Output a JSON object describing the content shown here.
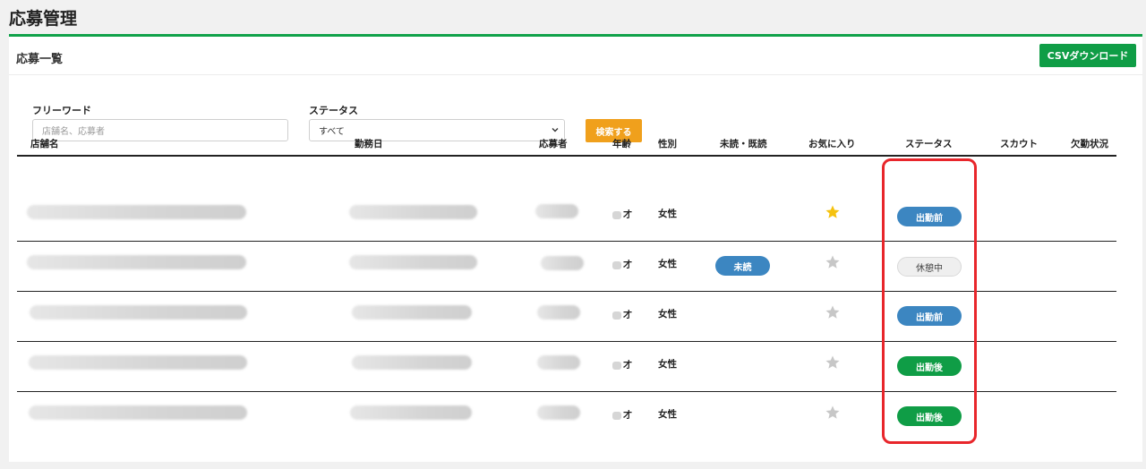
{
  "page_title": "応募管理",
  "card": {
    "title": "応募一覧",
    "csv_label": "CSVダウンロード"
  },
  "filters": {
    "freeword_label": "フリーワード",
    "freeword_placeholder": "店舗名、応募者",
    "status_label": "ステータス",
    "status_value": "すべて",
    "search_label": "検索する"
  },
  "table": {
    "headers": {
      "store": "店舗名",
      "date": "勤務日",
      "applicant": "応募者",
      "age": "年齢",
      "gender": "性別",
      "read": "未読・既読",
      "favorite": "お気に入り",
      "status": "ステータス",
      "scout": "スカウト",
      "absence": "欠勤状況"
    },
    "rows": [
      {
        "age_suffix": "才",
        "gender": "女性",
        "read": "",
        "favorite": true,
        "status": "出勤前"
      },
      {
        "age_suffix": "才",
        "gender": "女性",
        "read": "未読",
        "favorite": false,
        "status": "休憩中"
      },
      {
        "age_suffix": "才",
        "gender": "女性",
        "read": "",
        "favorite": false,
        "status": "出勤前"
      },
      {
        "age_suffix": "才",
        "gender": "女性",
        "read": "",
        "favorite": false,
        "status": "出勤後"
      },
      {
        "age_suffix": "才",
        "gender": "女性",
        "read": "",
        "favorite": false,
        "status": "出勤後"
      }
    ]
  },
  "colors": {
    "accent_green": "#0f9d46",
    "status_before": "#3c86c1",
    "status_break": "#efefef",
    "status_after": "#0f9d46",
    "unread": "#3c86c1",
    "star_on": "#f5c20f",
    "star_off": "#c7c7c7",
    "highlight": "#e8262b"
  },
  "icons": {
    "favorite": "star-icon",
    "select": "chevron-down-icon"
  }
}
